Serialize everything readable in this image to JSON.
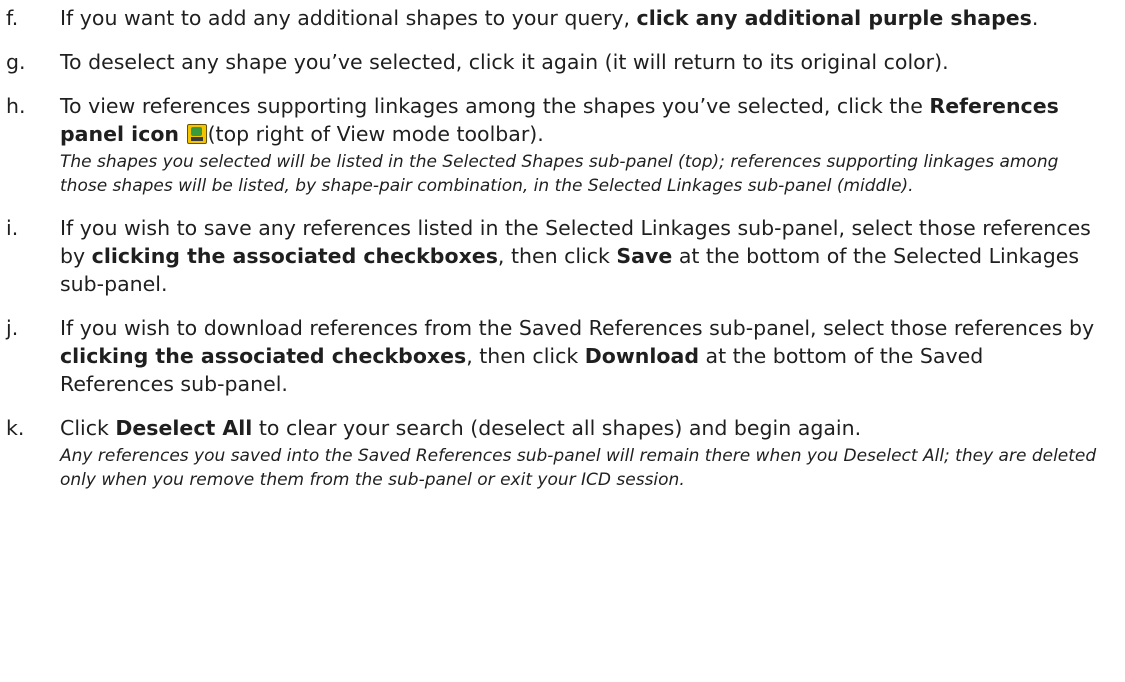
{
  "steps": [
    {
      "letter": "f.",
      "parts": [
        {
          "t": "If you want to add any additional shapes to your query, "
        },
        {
          "t": "click any additional purple shapes",
          "b": true
        },
        {
          "t": "."
        }
      ]
    },
    {
      "letter": "g.",
      "parts": [
        {
          "t": "To deselect any shape you’ve selected, click it again (it will return to its original color)."
        }
      ]
    },
    {
      "letter": "h.",
      "parts": [
        {
          "t": "To view references supporting linkages among the shapes you’ve selected, click the "
        },
        {
          "t": "References panel icon",
          "b": true
        },
        {
          "t": " "
        },
        {
          "icon": "references-panel-icon"
        },
        {
          "t": "(top right of View mode toolbar)."
        }
      ],
      "note": "The shapes you selected will be listed in the Selected Shapes sub-panel (top); references supporting linkages among those shapes will be listed, by shape-pair combination, in the Selected Linkages sub-panel (middle)."
    },
    {
      "letter": "i.",
      "parts": [
        {
          "t": "If you wish to save any references listed in the Selected Linkages sub-panel, select those references by "
        },
        {
          "t": "clicking the associated checkboxes",
          "b": true
        },
        {
          "t": ", then click "
        },
        {
          "t": "Save",
          "b": true
        },
        {
          "t": " at the bottom of the Selected Linkages sub-panel."
        }
      ]
    },
    {
      "letter": "j.",
      "parts": [
        {
          "t": "If you wish to download references from the Saved References sub-panel, select those references by "
        },
        {
          "t": "clicking the associated checkboxes",
          "b": true
        },
        {
          "t": ", then click "
        },
        {
          "t": "Download",
          "b": true
        },
        {
          "t": " at the bottom of the Saved References sub-panel."
        }
      ]
    },
    {
      "letter": "k.",
      "parts": [
        {
          "t": "Click "
        },
        {
          "t": "Deselect All",
          "b": true
        },
        {
          "t": " to clear your search (deselect all shapes) and begin again."
        }
      ],
      "note": "Any references you saved into the Saved References sub-panel will remain there when you Deselect All; they are deleted only when you remove them from the sub-panel or exit your ICD session."
    }
  ]
}
